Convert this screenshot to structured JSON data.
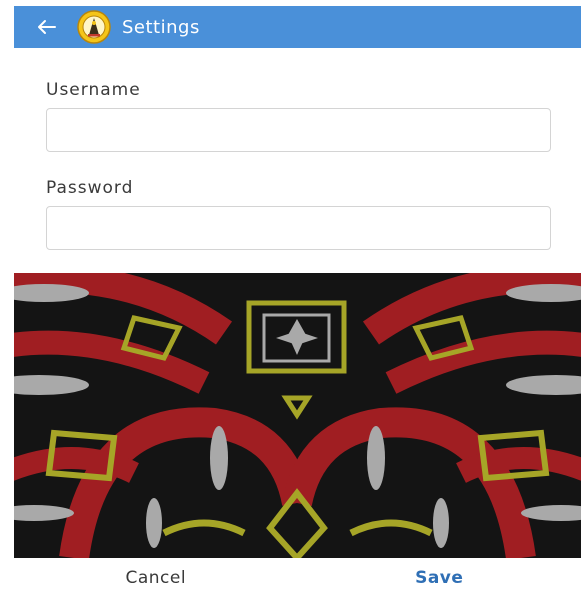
{
  "header": {
    "title": "Settings",
    "back_icon": "arrow-left-icon",
    "logo_icon": "emblem-logo-icon",
    "bar_color": "#4a90d9"
  },
  "form": {
    "username": {
      "label": "Username",
      "value": "",
      "placeholder": ""
    },
    "password": {
      "label": "Password",
      "value": "",
      "placeholder": ""
    }
  },
  "banner": {
    "colors": {
      "background": "#141414",
      "red": "#a01e22",
      "olive": "#a6a527",
      "grey": "#a9a9a9"
    }
  },
  "footer": {
    "cancel_label": "Cancel",
    "save_label": "Save",
    "save_color": "#2f6fb5"
  }
}
